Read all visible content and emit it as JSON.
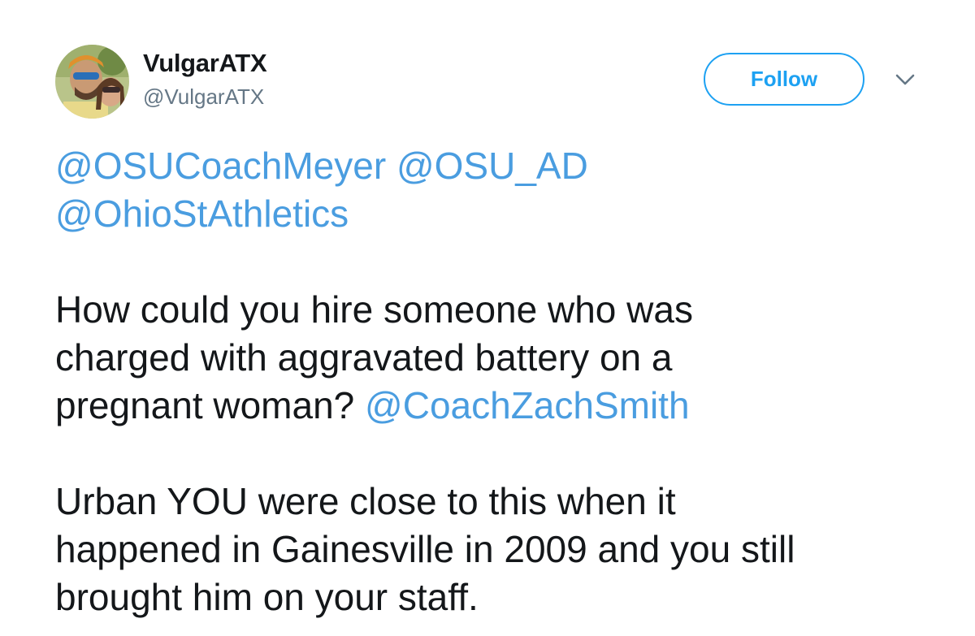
{
  "author": {
    "display_name": "VulgarATX",
    "handle": "@VulgarATX"
  },
  "actions": {
    "follow_label": "Follow",
    "more_icon": "chevron-down-icon"
  },
  "tweet": {
    "mentions_line1": [
      "@OSUCoachMeyer",
      "@OSU_AD"
    ],
    "mentions_line2": "@OhioStAthletics",
    "para1_line1": "How could you hire someone who was",
    "para1_line2": "charged with aggravated battery on a",
    "para1_line3_text": "pregnant woman?",
    "para1_line3_mention": "@CoachZachSmith",
    "para2_line1": "Urban YOU were close to this when it",
    "para2_line2": "happened in Gainesville in 2009 and you still",
    "para2_line3": "brought him on your staff."
  },
  "colors": {
    "accent": "#1da1f2",
    "mention": "#4a9de0",
    "text": "#14171a",
    "muted": "#657786"
  }
}
